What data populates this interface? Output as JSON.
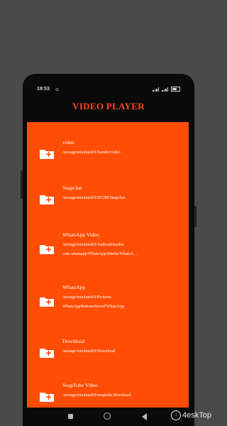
{
  "status": {
    "time": "19:53",
    "extra": "⊙"
  },
  "app": {
    "title": "VIDEO PLAYER"
  },
  "folders": [
    {
      "name": "video",
      "path_lines": [
        "/storage/emulated/0/Xender/video"
      ]
    },
    {
      "name": "Snapchat",
      "path_lines": [
        "/storage/emulated/0/DCIM/Snapchat"
      ]
    },
    {
      "name": "WhatsApp Video",
      "path_lines": [
        "/storage/emulated/0/Android/media/",
        "com.whatsapp/WhatsApp/Media/WhatsA…"
      ]
    },
    {
      "name": "WhatsApp",
      "path_lines": [
        "/storage/emulated/0/Pictures/",
        "WhatsAppStatusesSaved/WhatsApp"
      ]
    },
    {
      "name": "Download",
      "path_lines": [
        "/storage/emulated/0/Download"
      ]
    },
    {
      "name": "SnapTube Video",
      "path_lines": [
        "/storage/emulated/0/snaptube/download/"
      ]
    }
  ],
  "colors": {
    "accent": "#ff4d05",
    "title": "#ff4a1a",
    "background": "#4a4a4a",
    "phone": "#0a0a0a"
  },
  "icons": {
    "folder": "folder-add-icon"
  },
  "watermark": {
    "text": "4eskTop"
  }
}
